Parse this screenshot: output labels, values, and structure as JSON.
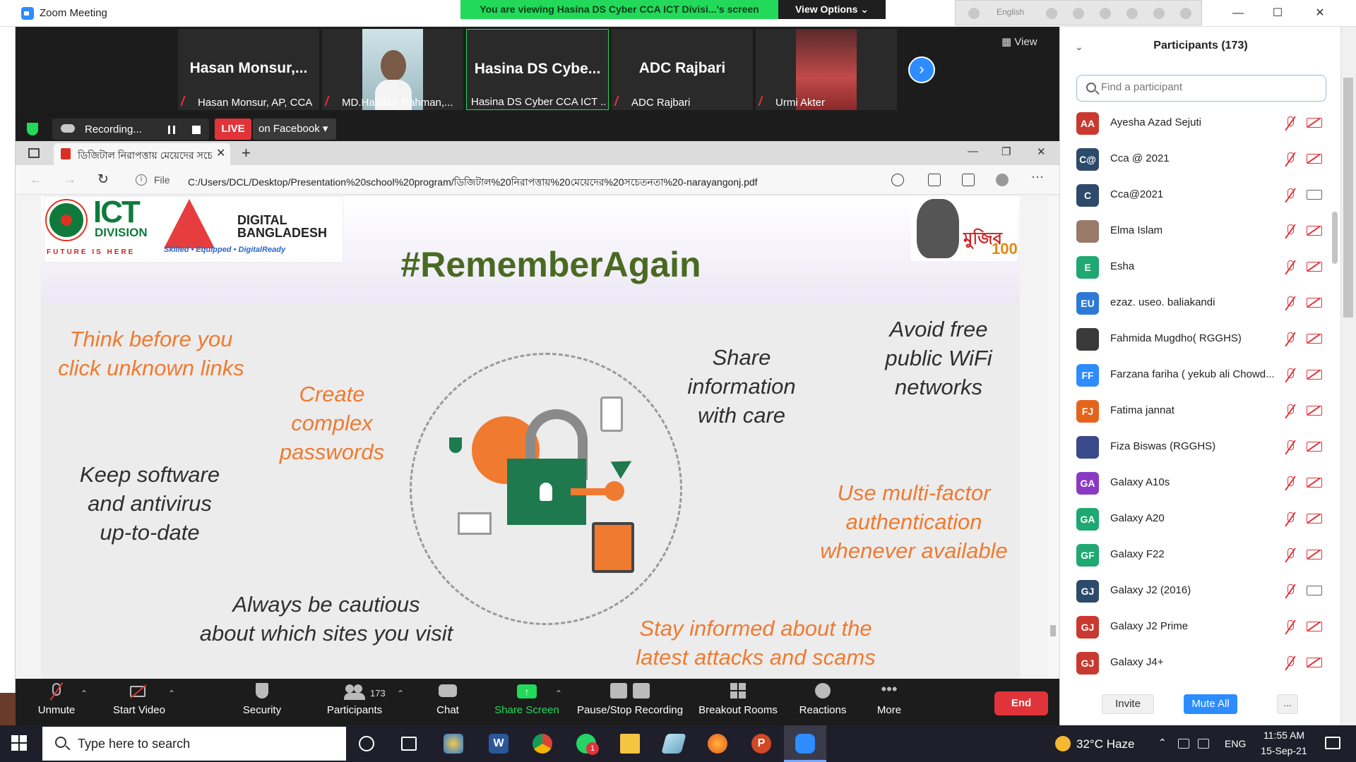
{
  "window": {
    "title": "Zoom Meeting",
    "viewing_banner": "You are viewing Hasina DS Cyber CCA ICT Divisi...'s screen",
    "view_options": "View Options",
    "language": "English",
    "minimize": "—",
    "maximize": "☐",
    "close": "✕"
  },
  "thumbnails": {
    "view_label": "View",
    "items": [
      {
        "big_name": "Hasan  Monsur,...",
        "label": "Hasan Monsur, AP, CCA",
        "muted": true,
        "has_video": false
      },
      {
        "big_name": "",
        "label": "MD.Habibur Rahman,...",
        "muted": true,
        "has_video": true
      },
      {
        "big_name": "Hasina DS Cybe...",
        "label": "Hasina DS Cyber CCA ICT ...",
        "muted": false,
        "has_video": false,
        "active": true
      },
      {
        "big_name": "ADC Rajbari",
        "label": "ADC Rajbari",
        "muted": true,
        "has_video": false
      },
      {
        "big_name": "",
        "label": "Urmi Akter",
        "muted": true,
        "has_video": true
      }
    ],
    "next_arrow": "›"
  },
  "recording": {
    "status": "Recording...",
    "live": "LIVE",
    "destination": "on Facebook ▾"
  },
  "browser": {
    "tab_title": "ডিজিটাল নিরাপত্তায় মেয়েদের সচে",
    "tab_close": "✕",
    "new_tab": "+",
    "back": "←",
    "forward": "→",
    "reload": "↻",
    "info": "i",
    "file_label": "File",
    "url": "C:/Users/DCL/Desktop/Presentation%20school%20program/ডিজিটাল%20নিরাপত্তায়%20মেয়েদের%20সচেতনতা%20-narayangonj.pdf",
    "more": "···",
    "minimize": "—",
    "restore": "❐",
    "close": "✕"
  },
  "slide": {
    "logo_ict_word": "ICT",
    "logo_ict_division": "DIVISION",
    "logo_ict_tagline": "FUTURE IS HERE",
    "logo_db_line1": "DIGITAL",
    "logo_db_line2": "BANGLADESH",
    "logo_db_tagline": "Skilled • Equipped • DigitalReady",
    "logo_mujib_text": "মুজিব",
    "logo_mujib_100": "100",
    "heading": "#RememberAgain",
    "tips": {
      "think": "Think before you\nclick unknown links",
      "passwords": "Create\ncomplex\npasswords",
      "share": "Share\ninformation\nwith care",
      "wifi": "Avoid free\npublic WiFi\nnetworks",
      "software": "Keep software\nand antivirus\nup-to-date",
      "mfa": "Use multi-factor\nauthentication\nwhenever available",
      "cautious": "Always be cautious\nabout which sites you visit",
      "informed": "Stay informed about the\nlatest attacks and scams"
    }
  },
  "toolbar": {
    "unmute": "Unmute",
    "start_video": "Start Video",
    "security": "Security",
    "participants": "Participants",
    "participants_count": "173",
    "chat": "Chat",
    "share_screen": "Share Screen",
    "pause_stop": "Pause/Stop Recording",
    "breakout": "Breakout Rooms",
    "reactions": "Reactions",
    "more": "More",
    "end": "End"
  },
  "panel": {
    "title": "Participants (173)",
    "search_placeholder": "Find a participant",
    "participants": [
      {
        "initials": "AA",
        "name": "Ayesha Azad Sejuti",
        "color": "#c9392f",
        "video": false
      },
      {
        "initials": "C@",
        "name": "Cca @ 2021",
        "color": "#2d4a6b",
        "video": false
      },
      {
        "initials": "C",
        "name": "Cca@2021",
        "color": "#2d4a6b",
        "video": true
      },
      {
        "initials": "",
        "name": "Elma Islam",
        "color": "#9a7a6a",
        "video": false
      },
      {
        "initials": "E",
        "name": "Esha",
        "color": "#1fa872",
        "video": false
      },
      {
        "initials": "EU",
        "name": "ezaz. useo. baliakandi",
        "color": "#2d7ad6",
        "video": false
      },
      {
        "initials": "",
        "name": "Fahmida Mugdho( RGGHS)",
        "color": "#3a3a3a",
        "video": false
      },
      {
        "initials": "FF",
        "name": "Farzana fariha ( yekub ali Chowd...",
        "color": "#2d8cff",
        "video": false
      },
      {
        "initials": "FJ",
        "name": "Fatima jannat",
        "color": "#e5641c",
        "video": false
      },
      {
        "initials": "",
        "name": "Fiza Biswas (RGGHS)",
        "color": "#3a4a8a",
        "video": false
      },
      {
        "initials": "GA",
        "name": "Galaxy A10s",
        "color": "#8a3ac2",
        "video": false
      },
      {
        "initials": "GA",
        "name": "Galaxy A20",
        "color": "#1fa872",
        "video": false
      },
      {
        "initials": "GF",
        "name": "Galaxy F22",
        "color": "#1fa872",
        "video": false
      },
      {
        "initials": "GJ",
        "name": "Galaxy J2 (2016)",
        "color": "#2d4a6b",
        "video": true
      },
      {
        "initials": "GJ",
        "name": "Galaxy J2 Prime",
        "color": "#c9392f",
        "video": false
      },
      {
        "initials": "GJ",
        "name": "Galaxy J4+",
        "color": "#c9392f",
        "video": false
      }
    ],
    "invite": "Invite",
    "mute_all": "Mute All",
    "more": "..."
  },
  "taskbar": {
    "search_placeholder": "Type here to search",
    "weather": "32°C  Haze",
    "language": "ENG",
    "time": "11:55 AM",
    "date": "15-Sep-21",
    "whatsapp_badge": "1"
  }
}
